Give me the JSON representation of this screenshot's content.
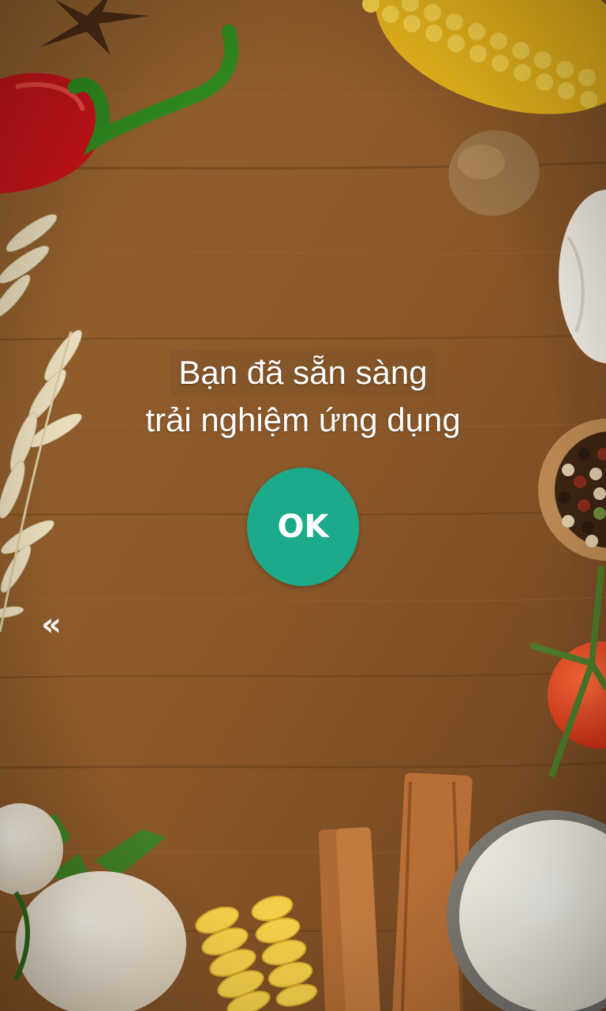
{
  "screen": {
    "message_line1": "Bạn đã sẵn sàng",
    "message_line2": "trải nghiệm ứng dụng",
    "ok_label": "OK",
    "back_label": "«"
  },
  "colors": {
    "accent": "#1cab8a",
    "text": "#ffffff",
    "wood": "#8a5a2b"
  },
  "icons": {
    "back": "double-chevron-left-icon"
  }
}
